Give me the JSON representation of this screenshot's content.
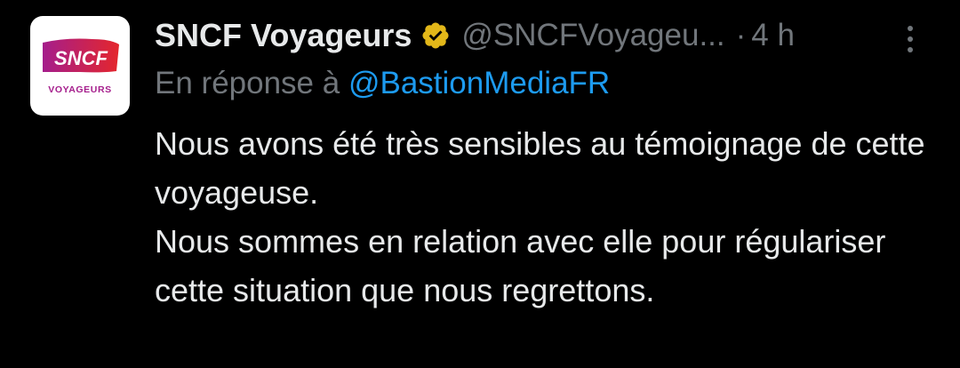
{
  "author": {
    "display_name": "SNCF Voyageurs",
    "handle": "@SNCFVoyageu...",
    "verified": true,
    "avatar_logo_text": "SNCF",
    "avatar_caption": "VOYAGEURS"
  },
  "meta": {
    "separator": "·",
    "time": "4 h"
  },
  "reply": {
    "prefix": "En réponse à",
    "mention": "@BastionMediaFR"
  },
  "body": {
    "paragraphs": [
      "Nous avons été très sensibles au témoignage de cette voyageuse.",
      "Nous sommes en relation avec elle pour régulariser cette situation que nous regrettons."
    ]
  },
  "icons": {
    "verified": "verified-badge-icon",
    "more": "more-options-icon"
  },
  "colors": {
    "background": "#000000",
    "primary_text": "#e7e9ea",
    "secondary_text": "#71767b",
    "link": "#1d9bf0",
    "verified_badge": "#e2b719",
    "brand_gradient_start": "#a51e8c",
    "brand_gradient_end": "#e4262c"
  }
}
